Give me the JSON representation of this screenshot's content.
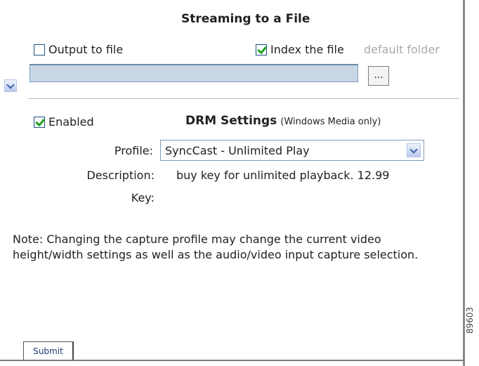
{
  "streaming": {
    "title": "Streaming to a File",
    "output_to_file_label": "Output to file",
    "output_to_file_checked": false,
    "index_the_file_label": "Index the file",
    "index_the_file_checked": true,
    "default_folder_label": "default folder",
    "path_value": "",
    "browse_label": "..."
  },
  "drm": {
    "enabled_label": "Enabled",
    "enabled_checked": true,
    "title": "DRM Settings",
    "title_note": "(Windows Media only)",
    "profile_label": "Profile:",
    "profile_value": "SyncCast - Unlimited Play",
    "description_label": "Description:",
    "description_value": "buy key for unlimited playback. 12.99",
    "key_label": "Key:",
    "key_value": ""
  },
  "note": "Note: Changing the capture profile may change the current video height/width settings as well as the audio/video input capture selection.",
  "submit_label": "Submit",
  "figure_id": "89603",
  "icons": {
    "checkbox_check": "checkmark-icon",
    "dropdown": "chevron-down-icon"
  },
  "colors": {
    "check": "#21a121",
    "input_fill": "#c9d6e6",
    "muted_text": "#a9a9a9"
  }
}
